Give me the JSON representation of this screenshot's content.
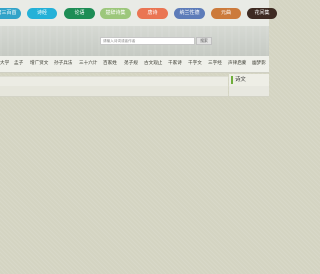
{
  "top_nav": {
    "buttons": [
      {
        "label": "唐三百首",
        "color": "#31a3c9"
      },
      {
        "label": "诗经",
        "color": "#24b1d8"
      },
      {
        "label": "论语",
        "color": "#1d8d55"
      },
      {
        "label": "楚辞诗集",
        "color": "#9cc77b"
      },
      {
        "label": "唐诗",
        "color": "#ea7553"
      },
      {
        "label": "纳兰性德",
        "color": "#5d7cb9"
      },
      {
        "label": "元曲",
        "color": "#cc7a3b"
      },
      {
        "label": "花间集",
        "color": "#3e2a22"
      }
    ]
  },
  "search": {
    "placeholder": "请输入诗词或者作者",
    "button_label": "搜索"
  },
  "main_nav": {
    "links": [
      "大学",
      "孟子",
      "增广贤文",
      "孙子兵法",
      "三十六计",
      "百家姓",
      "弟子规",
      "古文观止",
      "千家诗",
      "千字文",
      "三字经",
      "声律启蒙",
      "幽梦影"
    ]
  },
  "sidebar": {
    "title": "诗文"
  }
}
